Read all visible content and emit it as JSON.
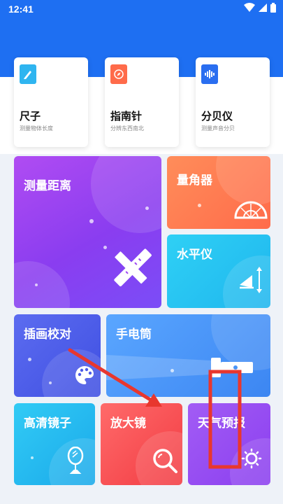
{
  "status_bar": {
    "time": "12:41"
  },
  "quick_tools": [
    {
      "title": "尺子",
      "subtitle": "测量物体长度",
      "icon": "ruler-icon",
      "color": "#2fb5f0"
    },
    {
      "title": "指南针",
      "subtitle": "分辨东西南北",
      "icon": "compass-icon",
      "color": "#ff6b4a"
    },
    {
      "title": "分贝仪",
      "subtitle": "测量声音分贝",
      "icon": "sound-wave-icon",
      "color": "#2a6ef0"
    }
  ],
  "tiles": {
    "distance": "测量距离",
    "protractor": "量角器",
    "level": "水平仪",
    "draw": "插画校对",
    "flashlight": "手电筒",
    "mirror": "高清镜子",
    "magnifier": "放大镜",
    "weather": "天气预报"
  },
  "annotation_colors": {
    "arrow": "#e8372e",
    "highlight_box": "#e8372e"
  }
}
